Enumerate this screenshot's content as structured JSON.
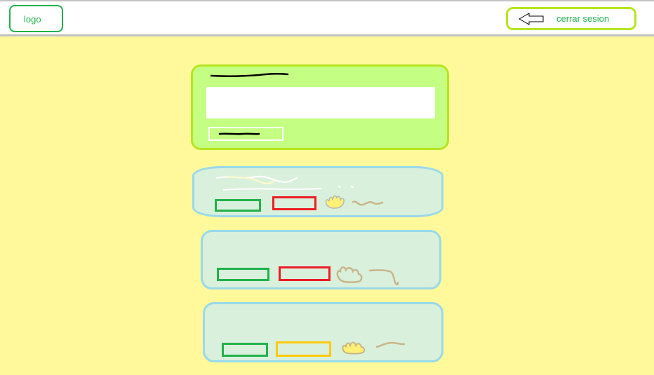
{
  "header": {
    "logo_label": "logo",
    "logout_label": "cerrar sesion",
    "logout_icon": "arrow-left-icon"
  },
  "colors": {
    "background": "#fff99c",
    "header_border": "#c3c3c3",
    "green_accent": "#22b14c",
    "lime_border": "#b5e61d",
    "form_fill": "#c4ff84",
    "card_fill": "#d9f0dc",
    "card_border": "#99d9ea",
    "red_accent": "#ed1c24",
    "yellow_accent": "#ffc90e"
  },
  "post_form": {
    "input_value": "",
    "title_icon": "scribble-line-icon",
    "button_icon": "scribble-line-icon"
  },
  "cards": [
    {
      "button_1_color": "green",
      "button_2_color": "red",
      "icon_1": "hand-doodle-icon",
      "icon_2": "squiggle-icon"
    },
    {
      "button_1_color": "green",
      "button_2_color": "red",
      "icon_1": "hand-doodle-icon",
      "icon_2": "squiggle-icon"
    },
    {
      "button_1_color": "green",
      "button_2_color": "yellow",
      "icon_1": "hand-doodle-icon",
      "icon_2": "squiggle-icon"
    }
  ]
}
